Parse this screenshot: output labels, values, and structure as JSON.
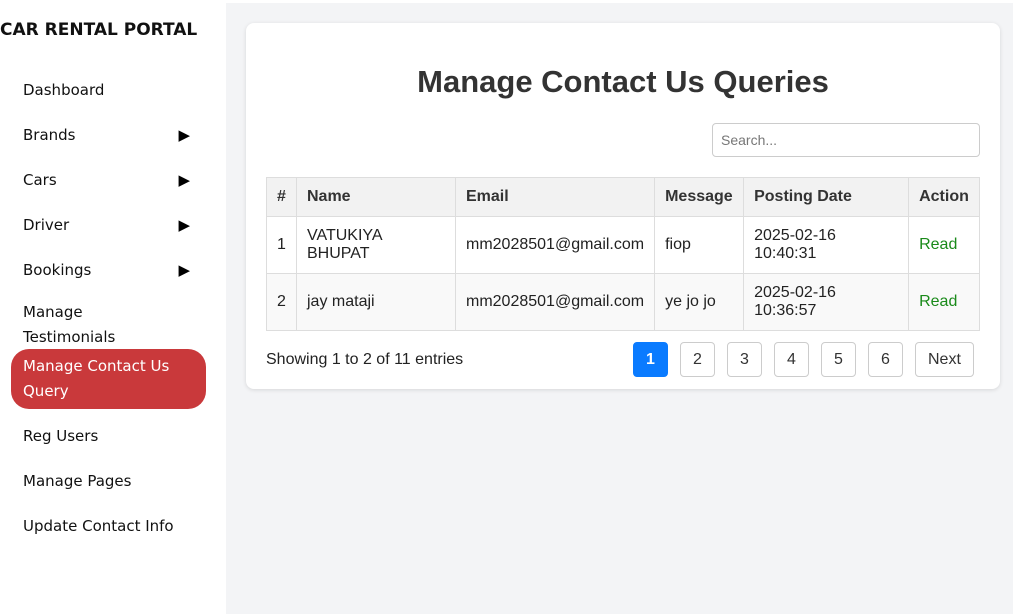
{
  "sidebar": {
    "brand": "CAR RENTAL PORTAL",
    "items": [
      {
        "label": "Dashboard"
      },
      {
        "label": "Brands"
      },
      {
        "label": "Cars"
      },
      {
        "label": "Driver"
      },
      {
        "label": "Bookings"
      },
      {
        "label": "Manage Testimonials"
      },
      {
        "label": "Manage Contact Us Query"
      },
      {
        "label": "Reg Users"
      },
      {
        "label": "Manage Pages"
      },
      {
        "label": "Update Contact Info"
      }
    ],
    "caret": "▶",
    "active_color": "#c9393b"
  },
  "main": {
    "title": "Manage Contact Us Queries",
    "search": {
      "placeholder": "Search...",
      "value": ""
    },
    "table": {
      "headers": [
        "#",
        "Name",
        "Email",
        "Message",
        "Posting Date",
        "Action"
      ],
      "rows": [
        {
          "num": "1",
          "name": "VATUKIYA BHUPAT",
          "email": "mm2028501@gmail.com",
          "message": "fiop",
          "date": "2025-02-16 10:40:31",
          "action": "Read"
        },
        {
          "num": "2",
          "name": "jay mataji",
          "email": "mm2028501@gmail.com",
          "message": "ye jo jo",
          "date": "2025-02-16 10:36:57",
          "action": "Read"
        }
      ]
    },
    "info": "Showing 1 to 2 of 11 entries",
    "pagination": {
      "pages": [
        "1",
        "2",
        "3",
        "4",
        "5",
        "6"
      ],
      "active": "1",
      "next": "Next",
      "active_color": "#0a7bff"
    }
  }
}
